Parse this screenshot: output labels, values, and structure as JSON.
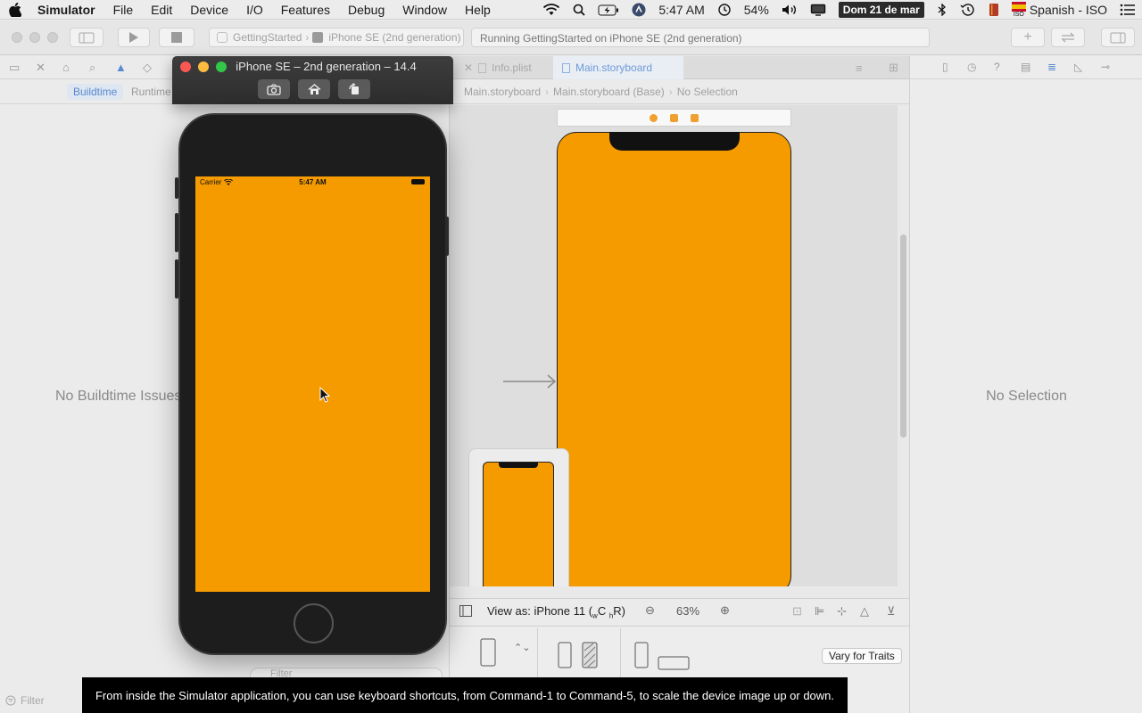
{
  "menubar": {
    "app_name": "Simulator",
    "items": [
      "File",
      "Edit",
      "Device",
      "I/O",
      "Features",
      "Debug",
      "Window",
      "Help"
    ],
    "clock": "5:47 AM",
    "battery_percent": "54%",
    "date": "Dom 21 de mar",
    "input_source": "Spanish - ISO",
    "flag_label": "ISO"
  },
  "toolbar": {
    "scheme_project": "GettingStarted",
    "scheme_device": "iPhone SE (2nd generation)",
    "activity_status": "Running GettingStarted on iPhone SE (2nd generation)"
  },
  "navigator": {
    "segments": [
      "Buildtime",
      "Runtime"
    ],
    "empty_message": "No Buildtime Issues",
    "filter_placeholder": "Filter",
    "secondary_filter_placeholder": "Filter"
  },
  "editor": {
    "tabs": [
      "Info.plist",
      "Main.storyboard"
    ],
    "jumpbar": [
      "Main.storyboard",
      "Main.storyboard (Base)",
      "No Selection"
    ],
    "view_as_label": "View as: iPhone 11 (",
    "size_class_w": "w",
    "size_class_c": "C",
    "size_class_h": "h",
    "size_class_r": "R)",
    "zoom_level": "63%",
    "vary_button": "Vary for Traits",
    "canvas_color": "#f59b00"
  },
  "inspector": {
    "empty_message": "No Selection"
  },
  "simulator": {
    "window_title": "iPhone SE – 2nd generation – 14.4",
    "carrier": "Carrier",
    "clock": "5:47 AM",
    "screen_color": "#f59b00"
  },
  "caption": {
    "text": "From inside the Simulator application, you can use keyboard shortcuts, from Command-1 to Command-5, to scale the device image up or down."
  }
}
